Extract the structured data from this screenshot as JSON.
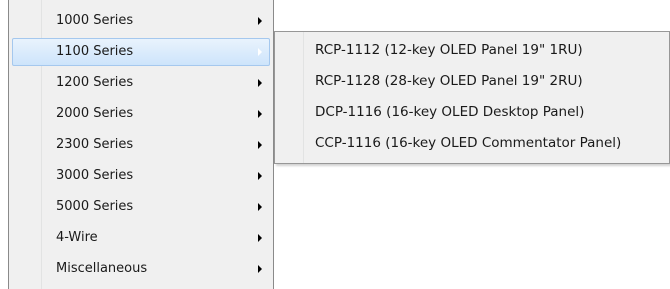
{
  "menu": {
    "items": [
      {
        "label": "1000 Series",
        "has_submenu": true,
        "active": false
      },
      {
        "label": "1100 Series",
        "has_submenu": true,
        "active": true
      },
      {
        "label": "1200 Series",
        "has_submenu": true,
        "active": false
      },
      {
        "label": "2000 Series",
        "has_submenu": true,
        "active": false
      },
      {
        "label": "2300 Series",
        "has_submenu": true,
        "active": false
      },
      {
        "label": "3000 Series",
        "has_submenu": true,
        "active": false
      },
      {
        "label": "5000 Series",
        "has_submenu": true,
        "active": false
      },
      {
        "label": "4-Wire",
        "has_submenu": true,
        "active": false
      },
      {
        "label": "Miscellaneous",
        "has_submenu": true,
        "active": false
      }
    ]
  },
  "submenu": {
    "items": [
      {
        "label": "RCP-1112 (12-key OLED Panel 19\" 1RU)"
      },
      {
        "label": "RCP-1128 (28-key OLED Panel 19\" 2RU)"
      },
      {
        "label": "DCP-1116 (16-key OLED Desktop Panel)"
      },
      {
        "label": "CCP-1116 (16-key OLED Commentator Panel)"
      }
    ]
  },
  "colors": {
    "menu_bg": "#f0f0f0",
    "highlight_border": "#a5c8ee",
    "highlight_fill": "#cde4fb",
    "text": "#1a1a1a"
  },
  "icons": {
    "submenu_arrow": "chevron-right-icon"
  }
}
